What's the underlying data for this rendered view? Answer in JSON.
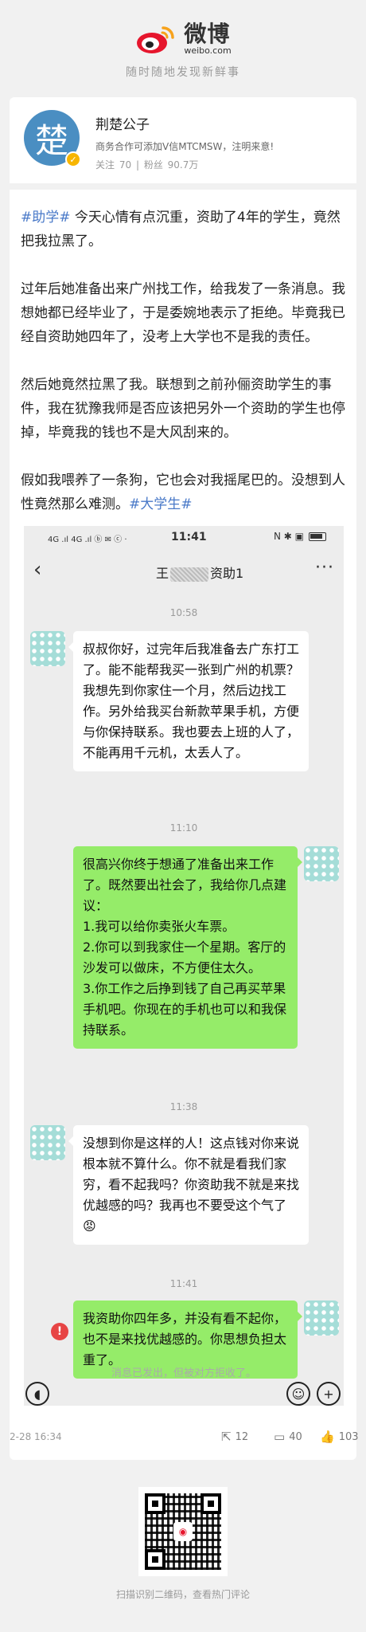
{
  "brand": {
    "name": "微博",
    "domain": "weibo.com",
    "slogan": "随时随地发现新鲜事"
  },
  "author": {
    "avatar_char": "楚",
    "name": "荆楚公子",
    "description": "商务合作可添加V信MTCMSW，注明来意!",
    "following_label": "关注",
    "following": "70",
    "fans_label": "粉丝",
    "fans": "90.7万"
  },
  "post": {
    "p1_tag": "#助学#",
    "p1_text": " 今天心情有点沉重，资助了4年的学生，竟然把我拉黑了。",
    "p2": "过年后她准备出来广州找工作，给我发了一条消息。我想她都已经毕业了，于是委婉地表示了拒绝。毕竟我已经自资助她四年了，没考上大学也不是我的责任。",
    "p3": "然后她竟然拉黑了我。联想到之前孙俪资助学生的事件，我在犹豫我师是否应该把另外一个资助的学生也停掉，毕竟我的钱也不是大风刮来的。",
    "p4_text": "假如我喂养了一条狗，它也会对我摇尾巴的。没想到人性竟然那么难测。",
    "p4_tag": "#大学生#"
  },
  "phone": {
    "status_left": "4G .ıl 4G .ıl ⓑ ✉ ⓒ ·",
    "time": "11:41",
    "status_right": "N ✱ ▣",
    "chat_title_prefix": "王",
    "chat_title_suffix": "资助1",
    "messages": [
      {
        "time": "10:58"
      },
      {
        "side": "left",
        "text": "叔叔你好，过完年后我准备去广东打工了。能不能帮我买一张到广州的机票？我想先到你家住一个月，然后边找工作。另外给我买台新款苹果手机，方便与你保持联系。我也要去上班的人了，不能再用千元机，太丢人了。"
      },
      {
        "time": "11:10"
      },
      {
        "side": "right",
        "text": "很高兴你终于想通了准备出来工作了。既然要出社会了，我给你几点建议：\n1.我可以给你卖张火车票。\n2.你可以到我家住一个星期。客厅的沙发可以做床，不方便住太久。\n3.你工作之后挣到钱了自己再买苹果手机吧。你现在的手机也可以和我保持联系。"
      },
      {
        "time": "11:38"
      },
      {
        "side": "left",
        "text": "没想到你是这样的人！这点钱对你来说根本就不算什么。你不就是看我们家穷，看不起我吗？你资助我不就是来找优越感的吗？我再也不要受这个气了😡"
      },
      {
        "time": "11:41"
      },
      {
        "side": "right",
        "text": "我资助你四年多，并没有看不起你，也不是来找优越感的。你思想负担太重了。"
      },
      {
        "system": "消息已发出，但被对方拒收了。"
      }
    ]
  },
  "footer": {
    "post_time": "2-28 16:34",
    "reposts": "12",
    "comments": "40",
    "likes": "103",
    "qr_caption": "扫描识别二维码，查看热门评论"
  }
}
